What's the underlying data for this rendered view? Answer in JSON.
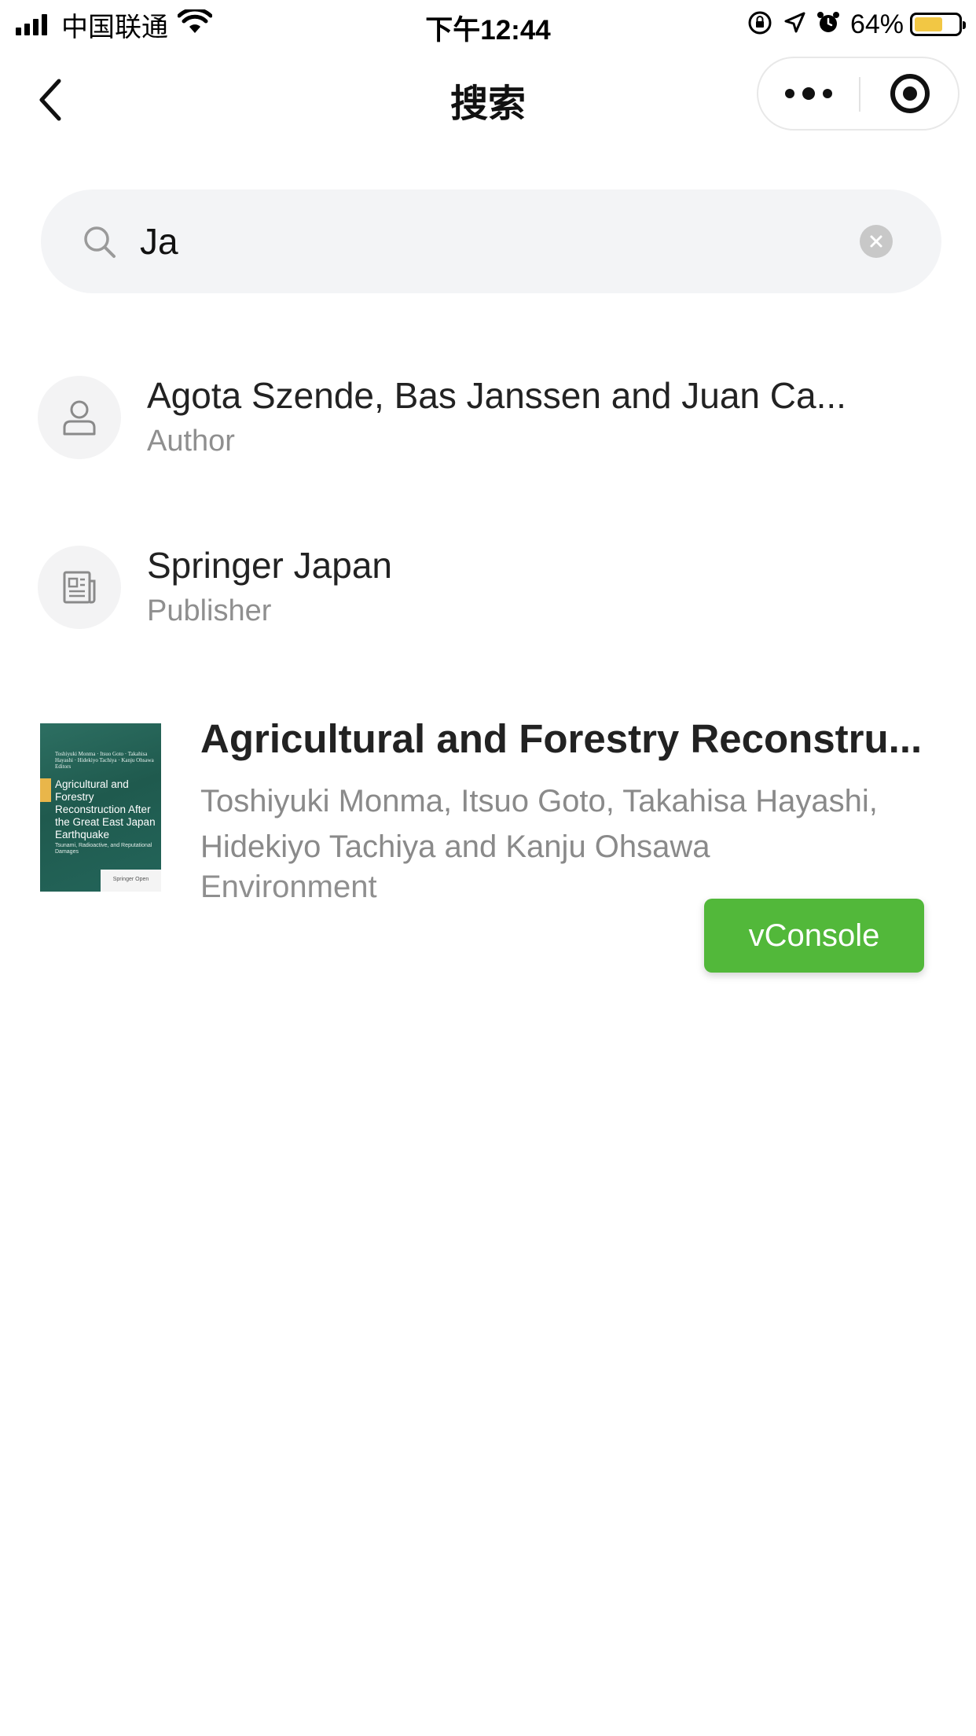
{
  "status_bar": {
    "carrier": "中国联通",
    "time": "下午12:44",
    "battery_percent": "64%",
    "battery_level": 0.64,
    "icons": [
      "signal-icon",
      "wifi-icon",
      "orientation-lock-icon",
      "location-icon",
      "alarm-icon",
      "battery-icon"
    ]
  },
  "nav": {
    "title": "搜索",
    "icons": [
      "back-chevron-icon",
      "more-dots-icon",
      "close-target-icon"
    ]
  },
  "search": {
    "value": "Ja",
    "placeholder": "",
    "icons": [
      "search-icon",
      "clear-icon"
    ]
  },
  "results": {
    "author": {
      "name": "Agota Szende, Bas Janssen and Juan Ca...",
      "type": "Author",
      "icon": "person-icon"
    },
    "publisher": {
      "name": "Springer Japan",
      "type": "Publisher",
      "icon": "newspaper-icon"
    },
    "book": {
      "title": "Agricultural and Forestry Reconstru...",
      "authors": "Toshiyuki Monma, Itsuo Goto, Takahisa Hayashi, Hidekiyo Tachiya and Kanju Ohsawa",
      "category": "Environment",
      "cover": {
        "editors": "Toshiyuki Monma · Itsuo Goto · Takahisa Hayashi · Hidekiyo Tachiya · Kanju Ohsawa  Editors",
        "title": "Agricultural and Forestry Reconstruction After the Great East Japan Earthquake",
        "subtitle": "Tsunami, Radioactive, and Reputational Damages",
        "publisher": "Springer Open",
        "color": "#23655a"
      }
    }
  },
  "vconsole": {
    "label": "vConsole",
    "color": "#52b83a"
  }
}
